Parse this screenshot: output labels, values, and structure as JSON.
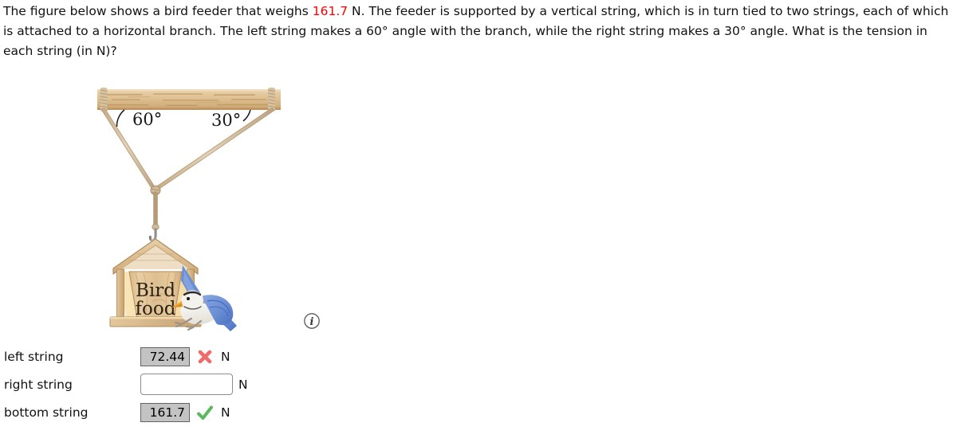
{
  "question": {
    "part1": "The figure below shows a bird feeder that weighs ",
    "weight_value": "161.7",
    "part2": " N. The feeder is supported by a vertical string, which is in turn tied to two strings, each of which is attached to a horizontal branch. The left string makes a 60° angle with the branch, while the right string makes a 30° angle. What is the tension in each string (in N)?"
  },
  "figure": {
    "left_angle_label": "60°",
    "right_angle_label": "30°",
    "feeder_text_line1": "Bird",
    "feeder_text_line2": "food",
    "info_icon_label": "i",
    "colors": {
      "wood_light": "#e2c89c",
      "wood_mid": "#d6b689",
      "wood_dark": "#b89464",
      "wood_grain": "#a8814f",
      "rope": "#d9c4a3",
      "rope_shade": "#b89d78",
      "bird_blue": "#6b8fd4",
      "bird_blue_dark": "#4a6fc0",
      "bird_body": "#f2f0ea",
      "bird_gray": "#a9a59b",
      "bird_beak": "#f0a830",
      "metal": "#9a9a9a"
    }
  },
  "answers": {
    "rows": [
      {
        "label": "left string",
        "value": "72.44",
        "state": "incorrect",
        "mark": "cross-icon",
        "unit": "N",
        "placeholder": ""
      },
      {
        "label": "right string",
        "value": "",
        "state": "empty",
        "mark": "none",
        "unit": "N",
        "placeholder": ""
      },
      {
        "label": "bottom string",
        "value": "161.7",
        "state": "correct",
        "mark": "check-icon",
        "unit": "N",
        "placeholder": ""
      }
    ],
    "colors": {
      "incorrect": "#ef6a6a",
      "correct": "#5cb85c"
    }
  }
}
